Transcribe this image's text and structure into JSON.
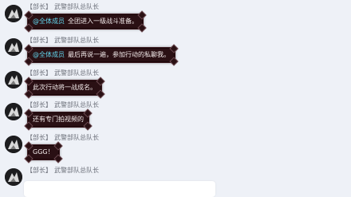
{
  "messages": [
    {
      "role": "【部长】",
      "name": "武警部队总队长",
      "mention": "@全体成员",
      "text": "全团进入一级战斗准备。"
    },
    {
      "role": "【部长】",
      "name": "武警部队总队长",
      "mention": "@全体成员",
      "text": "最后再说一遍，参加行动的私聊我。"
    },
    {
      "role": "【部长】",
      "name": "武警部队总队长",
      "mention": "",
      "text": "此次行动将一战成名。"
    },
    {
      "role": "【部长】",
      "name": "武警部队总队长",
      "mention": "",
      "text": "还有专门拍视频的"
    },
    {
      "role": "【部长】",
      "name": "武警部队总队长",
      "mention": "",
      "text": "GGG！"
    },
    {
      "role": "【部长】",
      "name": "武警部队总队长",
      "mention": "",
      "text": ""
    }
  ],
  "colors": {
    "bubble_bg": "#2a1014",
    "mention": "#62d6ee",
    "page_bg": "#eef1f7"
  }
}
